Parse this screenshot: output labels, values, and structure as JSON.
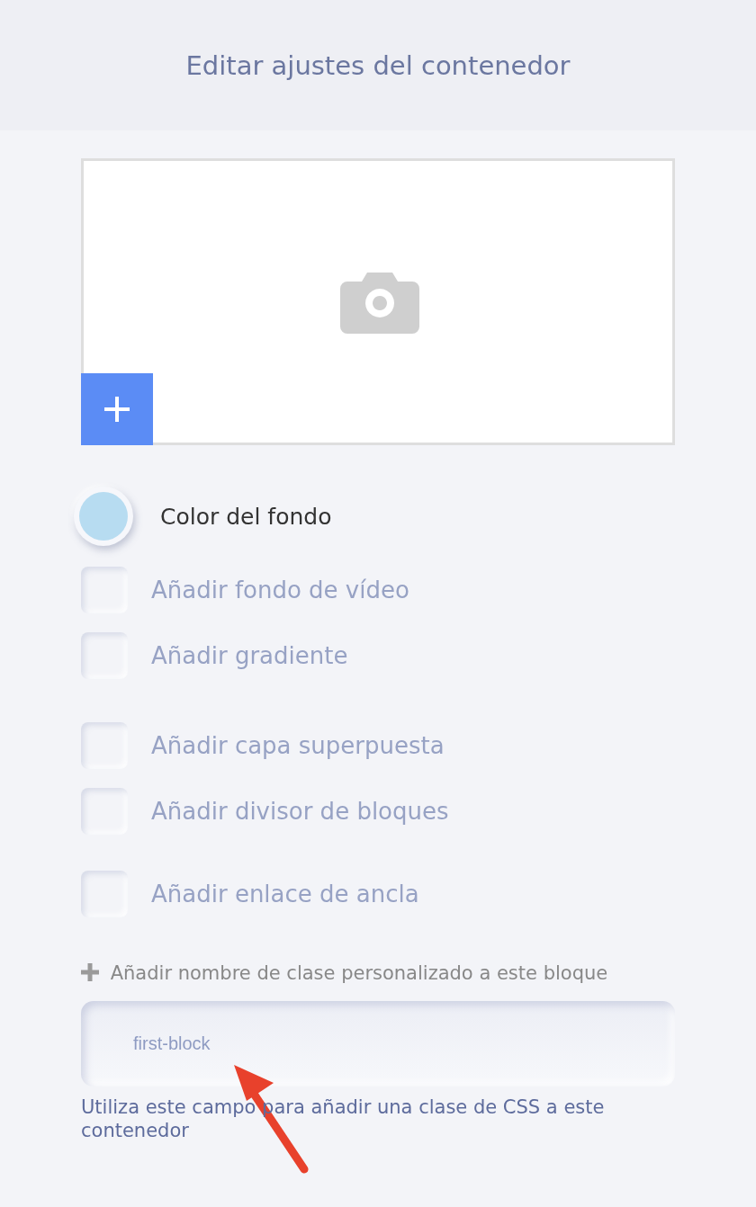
{
  "header": {
    "title": "Editar ajustes del contenedor"
  },
  "background_color": {
    "label": "Color del fondo",
    "color": "#b7dcf1"
  },
  "options": [
    {
      "label": "Añadir fondo de vídeo",
      "checked": false
    },
    {
      "label": "Añadir gradiente",
      "checked": false
    },
    {
      "label": "Añadir capa superpuesta",
      "checked": false
    },
    {
      "label": "Añadir divisor de bloques",
      "checked": false
    },
    {
      "label": "Añadir enlace de ancla",
      "checked": false
    }
  ],
  "class_field": {
    "label": "Añadir nombre de clase personalizado a este bloque",
    "value": "first-block",
    "help": "Utiliza este campo para añadir una clase de CSS a este contenedor"
  }
}
